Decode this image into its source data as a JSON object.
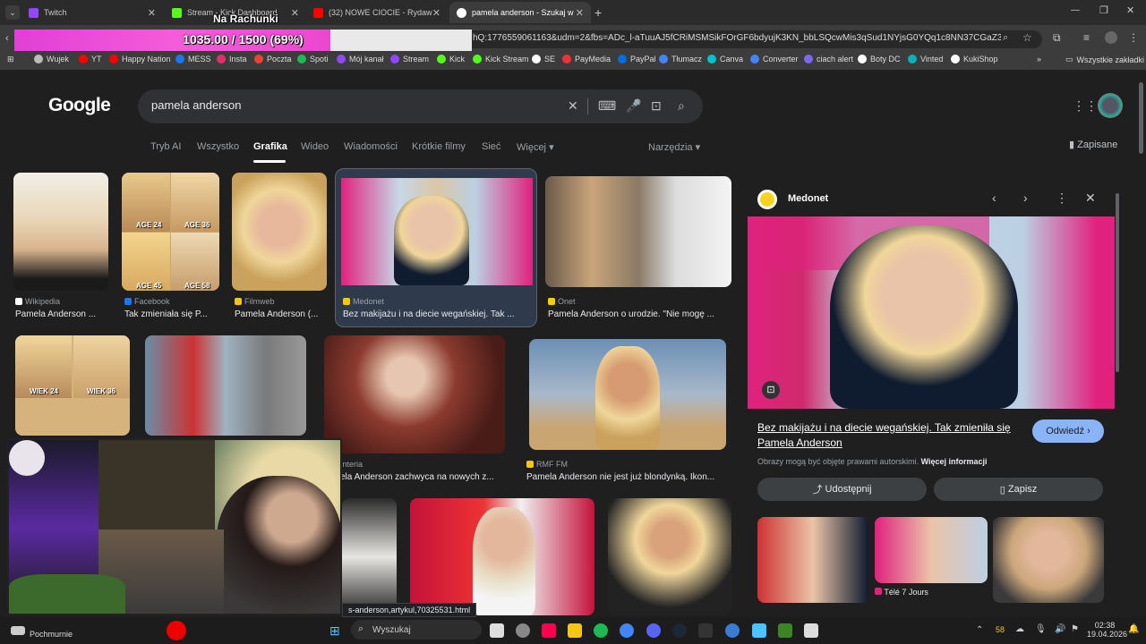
{
  "overlay": {
    "title": "Na Rachunki",
    "progress_label": "1035.00 / 1500 (69%)",
    "progress_fraction": 0.69
  },
  "tabs": [
    {
      "label": "Twitch",
      "color": "#9146ff"
    },
    {
      "label": "Stream - Kick Dashboard",
      "color": "#53fc18"
    },
    {
      "label": "(32) NOWE CIOCIE - Rydawarni",
      "color": "#ff0000"
    },
    {
      "label": "pamela anderson - Szukaj w Go",
      "color": "#ffffff"
    }
  ],
  "url": "hQ:1776559061163&udm=2&fbs=ADc_l-aTuuAJ5fCRiMSMSikFOrGF6bdyujK3KN_bbLSQcwMis3qSud1NYjsG0YQq1c8NN37CGaZ3p9YadokRf...",
  "bookmarks": [
    {
      "label": "Wujek",
      "color": "#bbb"
    },
    {
      "label": "YT",
      "color": "#f00"
    },
    {
      "label": "Happy Nation",
      "color": "#f00"
    },
    {
      "label": "MESS",
      "color": "#1877f2"
    },
    {
      "label": "Insta",
      "color": "#e1306c"
    },
    {
      "label": "Poczta",
      "color": "#ea4335"
    },
    {
      "label": "Spoti",
      "color": "#1db954"
    },
    {
      "label": "Mój kanał",
      "color": "#9146ff"
    },
    {
      "label": "Stream",
      "color": "#9146ff"
    },
    {
      "label": "Kick",
      "color": "#53fc18"
    },
    {
      "label": "Kick Stream",
      "color": "#53fc18"
    },
    {
      "label": "SE",
      "color": "#fff"
    },
    {
      "label": "PayMedia",
      "color": "#e33"
    },
    {
      "label": "PayPal",
      "color": "#0070e0"
    },
    {
      "label": "Tłumacz",
      "color": "#4285f4"
    },
    {
      "label": "Canva",
      "color": "#00c4cc"
    },
    {
      "label": "Converter",
      "color": "#4285f4"
    },
    {
      "label": "ciach alert",
      "color": "#7b68ee"
    },
    {
      "label": "Boty DC",
      "color": "#fff"
    },
    {
      "label": "Vinted",
      "color": "#09b1ba"
    },
    {
      "label": "KukiShop",
      "color": "#fff"
    }
  ],
  "all_bookmarks": "Wszystkie zakładki",
  "search": {
    "logo": "Google",
    "query": "pamela anderson"
  },
  "nav": {
    "tabs": [
      "Tryb AI",
      "Wszystko",
      "Grafika",
      "Wideo",
      "Wiadomości",
      "Krótkie filmy",
      "Sieć",
      "Więcej"
    ],
    "tools": "Narzędzia",
    "saved": "Zapisane"
  },
  "results": [
    {
      "source": "Wikipedia",
      "caption": "Pamela Anderson ..."
    },
    {
      "source": "Facebook",
      "caption": "Tak zmieniała się P..."
    },
    {
      "source": "Filmweb",
      "caption": "Pamela Anderson (..."
    },
    {
      "source": "Medonet",
      "caption": "Bez makijażu i na diecie wegańskiej. Tak ..."
    },
    {
      "source": "Onet",
      "caption": "Pamela Anderson o urodzie. \"Nie mogę ..."
    },
    {
      "source": "Interia",
      "caption": "ela Anderson zachwyca na nowych z..."
    },
    {
      "source": "RMF FM",
      "caption": "Pamela Anderson nie jest już blondynką. Ikon..."
    }
  ],
  "age_labels": [
    "AGE 24",
    "AGE 36",
    "AGE 45",
    "AGE 58",
    "WIEK 24",
    "WIEK 36"
  ],
  "panel": {
    "source": "Medonet",
    "title": "Bez makijażu i na diecie wegańskiej. Tak zmieniła się Pamela Anderson",
    "visit": "Odwiedź",
    "copyright": "Obrazy mogą być objęte prawami autorskimi.",
    "more_info": "Więcej informacji",
    "share": "Udostępnij",
    "save": "Zapisz",
    "related_source": "Télé 7 Jours"
  },
  "status_link": "s-anderson,artykul,70325531.html",
  "taskbar": {
    "weather": "Pochmurnie",
    "search": "Wyszukaj",
    "time": "02:38",
    "date": "19.04.2026",
    "badge": "58"
  }
}
